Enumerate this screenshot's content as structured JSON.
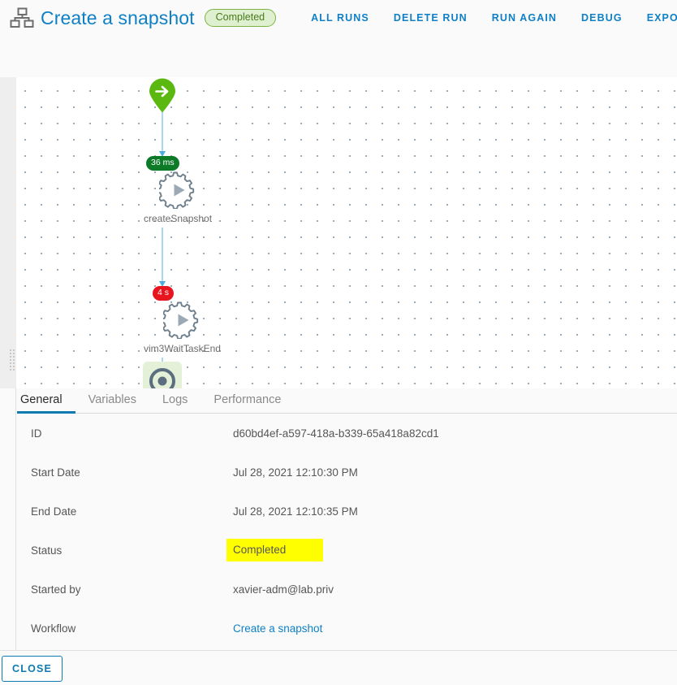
{
  "header": {
    "icon": "workflow-chart-icon",
    "title": "Create a snapshot",
    "status_badge": "Completed",
    "actions": [
      {
        "label": "ALL RUNS",
        "name": "all-runs"
      },
      {
        "label": "DELETE RUN",
        "name": "delete-run"
      },
      {
        "label": "RUN AGAIN",
        "name": "run-again"
      },
      {
        "label": "DEBUG",
        "name": "debug"
      },
      {
        "label": "EXPORT",
        "name": "export"
      }
    ]
  },
  "canvas": {
    "nodes": [
      {
        "type": "start",
        "icon": "start-arrow-pin-icon",
        "label": ""
      },
      {
        "type": "task",
        "icon": "gear-play-icon",
        "label": "createSnapshot",
        "duration": "36 ms",
        "duration_state": "green"
      },
      {
        "type": "task",
        "icon": "gear-play-icon",
        "label": "vim3WaitTaskEnd",
        "duration": "4 s",
        "duration_state": "red"
      },
      {
        "type": "end",
        "icon": "end-target-icon",
        "label": ""
      }
    ]
  },
  "tabs": [
    {
      "label": "General",
      "active": true
    },
    {
      "label": "Variables",
      "active": false
    },
    {
      "label": "Logs",
      "active": false
    },
    {
      "label": "Performance",
      "active": false
    }
  ],
  "details": [
    {
      "key": "ID",
      "value": "d60bd4ef-a597-418a-b339-65a418a82cd1",
      "style": "plain"
    },
    {
      "key": "Start Date",
      "value": "Jul 28, 2021 12:10:30 PM",
      "style": "plain"
    },
    {
      "key": "End Date",
      "value": "Jul 28, 2021 12:10:35 PM",
      "style": "plain"
    },
    {
      "key": "Status",
      "value": "Completed",
      "style": "highlight"
    },
    {
      "key": "Started by",
      "value": "xavier-adm@lab.priv",
      "style": "plain"
    },
    {
      "key": "Workflow",
      "value": "Create a snapshot",
      "style": "link"
    }
  ],
  "footer": {
    "close_label": "CLOSE"
  },
  "colors": {
    "accent_blue": "#0f80c5",
    "tab_underline": "#0f7ab0",
    "status_green": "#7cb342",
    "badge_green": "#0d7a28",
    "badge_red": "#e8141e",
    "highlight_yellow": "#ffff00"
  }
}
